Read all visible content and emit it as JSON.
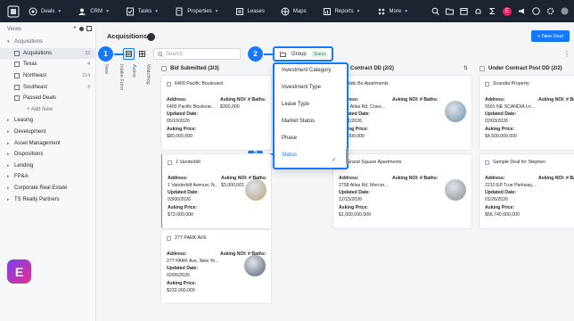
{
  "topbar": {
    "nav": [
      {
        "label": "Deals",
        "icon": "deals-icon"
      },
      {
        "label": "CRM",
        "icon": "crm-icon"
      },
      {
        "label": "Tasks",
        "icon": "tasks-icon"
      },
      {
        "label": "Properties",
        "icon": "properties-icon"
      },
      {
        "label": "Leases",
        "icon": "leases-icon"
      },
      {
        "label": "Maps",
        "icon": "maps-icon"
      },
      {
        "label": "Reports",
        "icon": "reports-icon"
      },
      {
        "label": "More",
        "icon": "more-icon"
      }
    ],
    "avatar_initial": "E"
  },
  "sidebar": {
    "header": "Views",
    "items": [
      {
        "label": "Acquisitions",
        "level": 0,
        "expanded": true
      },
      {
        "label": "Acquisitions",
        "level": 1,
        "count": "22",
        "selected": true
      },
      {
        "label": "Texas",
        "level": 1,
        "count": "4"
      },
      {
        "label": "Northeast",
        "level": 1,
        "count": "214"
      },
      {
        "label": "Southeast",
        "level": 1,
        "count": "3"
      },
      {
        "label": "Passed Deals",
        "level": 1
      },
      {
        "label": "+ Add New",
        "level": 2
      },
      {
        "label": "Leasing",
        "level": 0
      },
      {
        "label": "Development",
        "level": 0
      },
      {
        "label": "Asset Management",
        "level": 0
      },
      {
        "label": "Dispositions",
        "level": 0
      },
      {
        "label": "Lending",
        "level": 0
      },
      {
        "label": "FP&A",
        "level": 0
      },
      {
        "label": "Corporate Real Estate",
        "level": 0
      },
      {
        "label": "TS Realty Partners",
        "level": 0
      }
    ]
  },
  "main": {
    "title": "Acquisitions",
    "new_deal": "+ New Deal",
    "search_placeholder": "Search",
    "group_label": "Group",
    "group_value": "Status",
    "callouts": [
      "1",
      "2",
      "3"
    ],
    "vertical_cols": [
      "New",
      "Intake Form",
      "Active",
      "Watchlog"
    ]
  },
  "group_dropdown": {
    "options": [
      "Investment Category",
      "Investment Type",
      "Lease Type",
      "Market Status",
      "Phase",
      "Status"
    ],
    "selected": "Status"
  },
  "columns": [
    {
      "title": "Bid Submitted (3/3)"
    },
    {
      "title": "Under Contract DD (2/2)"
    },
    {
      "title": "Under Contract Post DD (2/2)"
    }
  ],
  "labels": {
    "address": "Address:",
    "asking_noi": "Asking NOI:",
    "baths": "# Baths:",
    "updated": "Updated Date:",
    "asking_price": "Asking Price:"
  },
  "cards": [
    {
      "name": "6400 Pacific Boulevard",
      "address": "6400 Pacific Boulevar...",
      "noi": "$300,000",
      "date": "05/10/2026",
      "price": "$80,000,000"
    },
    {
      "name": "1 Vanderbilt",
      "address": "1 Vanderbilt Avenue, N...",
      "noi": "$3,000,001",
      "date": "03/06/2026",
      "price": "$73,000,000"
    },
    {
      "name": "277 PARK AVE",
      "address": "277 PARK Ave, New Yo...",
      "noi": "",
      "date": "02/06/2026",
      "price": "$232,000,000"
    },
    {
      "name": "Aldo Bo Apartments",
      "address": "2758 Atlas Rd, Coeu...",
      "noi": "",
      "date": "12/31/2026",
      "price": "$40,000,000"
    },
    {
      "name": "Grand Square Apartments",
      "address": "2758 Atlas Rd, Mercer...",
      "noi": "",
      "date": "12/15/2026",
      "price": "$1,000,000,000"
    },
    {
      "name": "Scandia Property",
      "address": "5501 NE SCANDIA Ln...",
      "noi": "",
      "date": "02/03/2026",
      "price": "$4,500,000,000"
    },
    {
      "name": "Sample Deal for Stephen",
      "address": "2210 EP True Parkway,...",
      "noi": "",
      "date": "01/26/2026",
      "price": "$56,740,000,000"
    }
  ]
}
